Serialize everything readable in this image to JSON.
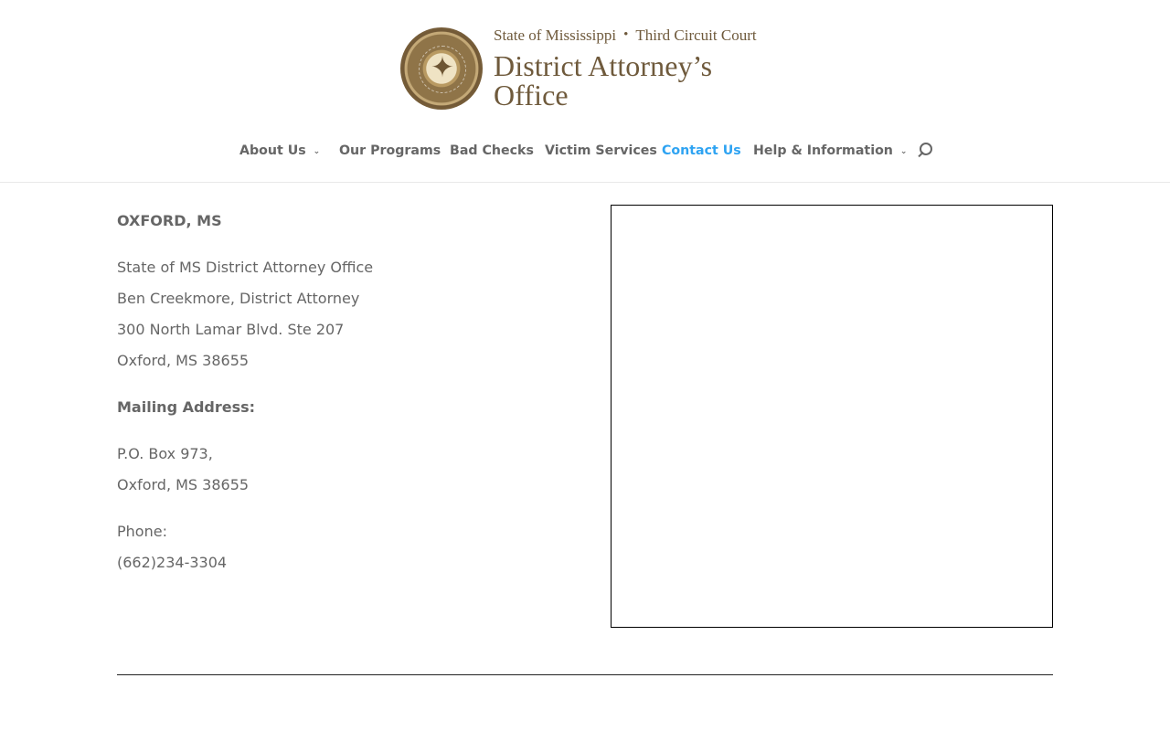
{
  "header": {
    "logo": {
      "seal_icon": "state-seal-icon",
      "top_left": "State of Mississippi",
      "separator": "•",
      "top_right": "Third Circuit Court",
      "main": "District Attorney’s Office"
    },
    "nav": {
      "items": [
        {
          "label": "About Us",
          "has_dropdown": true
        },
        {
          "label": "Our Programs",
          "has_dropdown": false
        },
        {
          "label": "Bad Checks",
          "has_dropdown": false
        },
        {
          "label": "Victim Services",
          "has_dropdown": false
        },
        {
          "label": "Contact Us",
          "has_dropdown": false,
          "active": true
        },
        {
          "label": "Help & Information",
          "has_dropdown": true
        }
      ],
      "search_icon": "search-icon",
      "active_color": "#2ea3f2",
      "text_color": "#666666"
    }
  },
  "content": {
    "location_heading": "OXFORD, MS",
    "office_lines": [
      "State of MS District Attorney Office",
      "Ben Creekmore, District Attorney",
      "300 North Lamar Blvd. Ste 207",
      "Oxford, MS 38655"
    ],
    "mailing_heading": "Mailing Address:",
    "mailing_lines": [
      "P.O. Box 973,",
      "Oxford, MS 38655"
    ],
    "phone_label": "Phone:",
    "phone": "(662)234-3304"
  },
  "colors": {
    "logo_brown": "#6f5a3c",
    "text_gray": "#666666",
    "accent_blue": "#2ea3f2"
  }
}
